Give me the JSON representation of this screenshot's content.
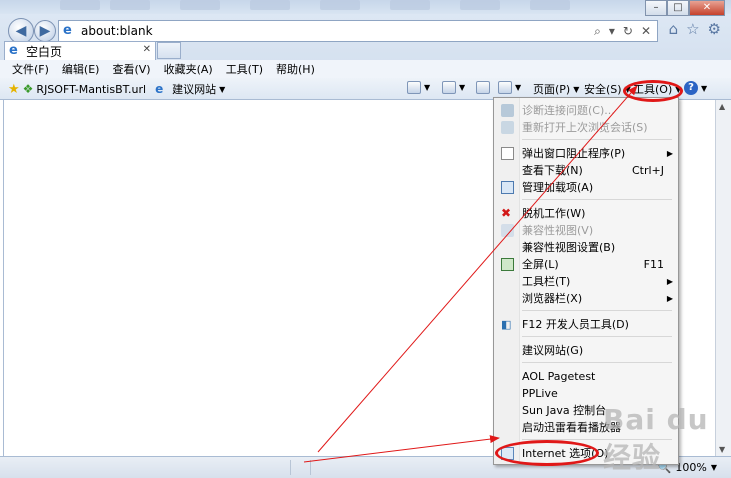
{
  "address": {
    "url": "about:blank"
  },
  "tab": {
    "title": "空白页"
  },
  "menubar": [
    "文件(F)",
    "编辑(E)",
    "查看(V)",
    "收藏夹(A)",
    "工具(T)",
    "帮助(H)"
  ],
  "favorites": {
    "item1": "RJSOFT-MantisBT.url",
    "item2": "建议网站"
  },
  "commandbar": {
    "page": "页面(P)",
    "safety": "安全(S)",
    "tools": "工具(O)"
  },
  "tools_menu": {
    "items": [
      {
        "label": "诊断连接问题(C)...",
        "disabled": true
      },
      {
        "label": "重新打开上次浏览会话(S)",
        "disabled": true
      },
      {
        "label": "弹出窗口阻止程序(P)",
        "submenu": true
      },
      {
        "label": "查看下载(N)",
        "shortcut": "Ctrl+J"
      },
      {
        "label": "管理加载项(A)"
      },
      {
        "label": "脱机工作(W)"
      },
      {
        "label": "兼容性视图(V)",
        "disabled": true
      },
      {
        "label": "兼容性视图设置(B)"
      },
      {
        "label": "全屏(L)",
        "shortcut": "F11"
      },
      {
        "label": "工具栏(T)",
        "submenu": true
      },
      {
        "label": "浏览器栏(X)",
        "submenu": true
      },
      {
        "label": "F12 开发人员工具(D)"
      },
      {
        "label": "建议网站(G)"
      },
      {
        "label": "AOL Pagetest"
      },
      {
        "label": "PPLive"
      },
      {
        "label": "Sun Java 控制台"
      },
      {
        "label": "启动迅雷看看播放器"
      },
      {
        "label": "Internet 选项(O)"
      }
    ]
  },
  "status": {
    "zoom": "100%"
  },
  "watermark": "Bai du 经验",
  "colors": {
    "annotation": "#e01818"
  }
}
